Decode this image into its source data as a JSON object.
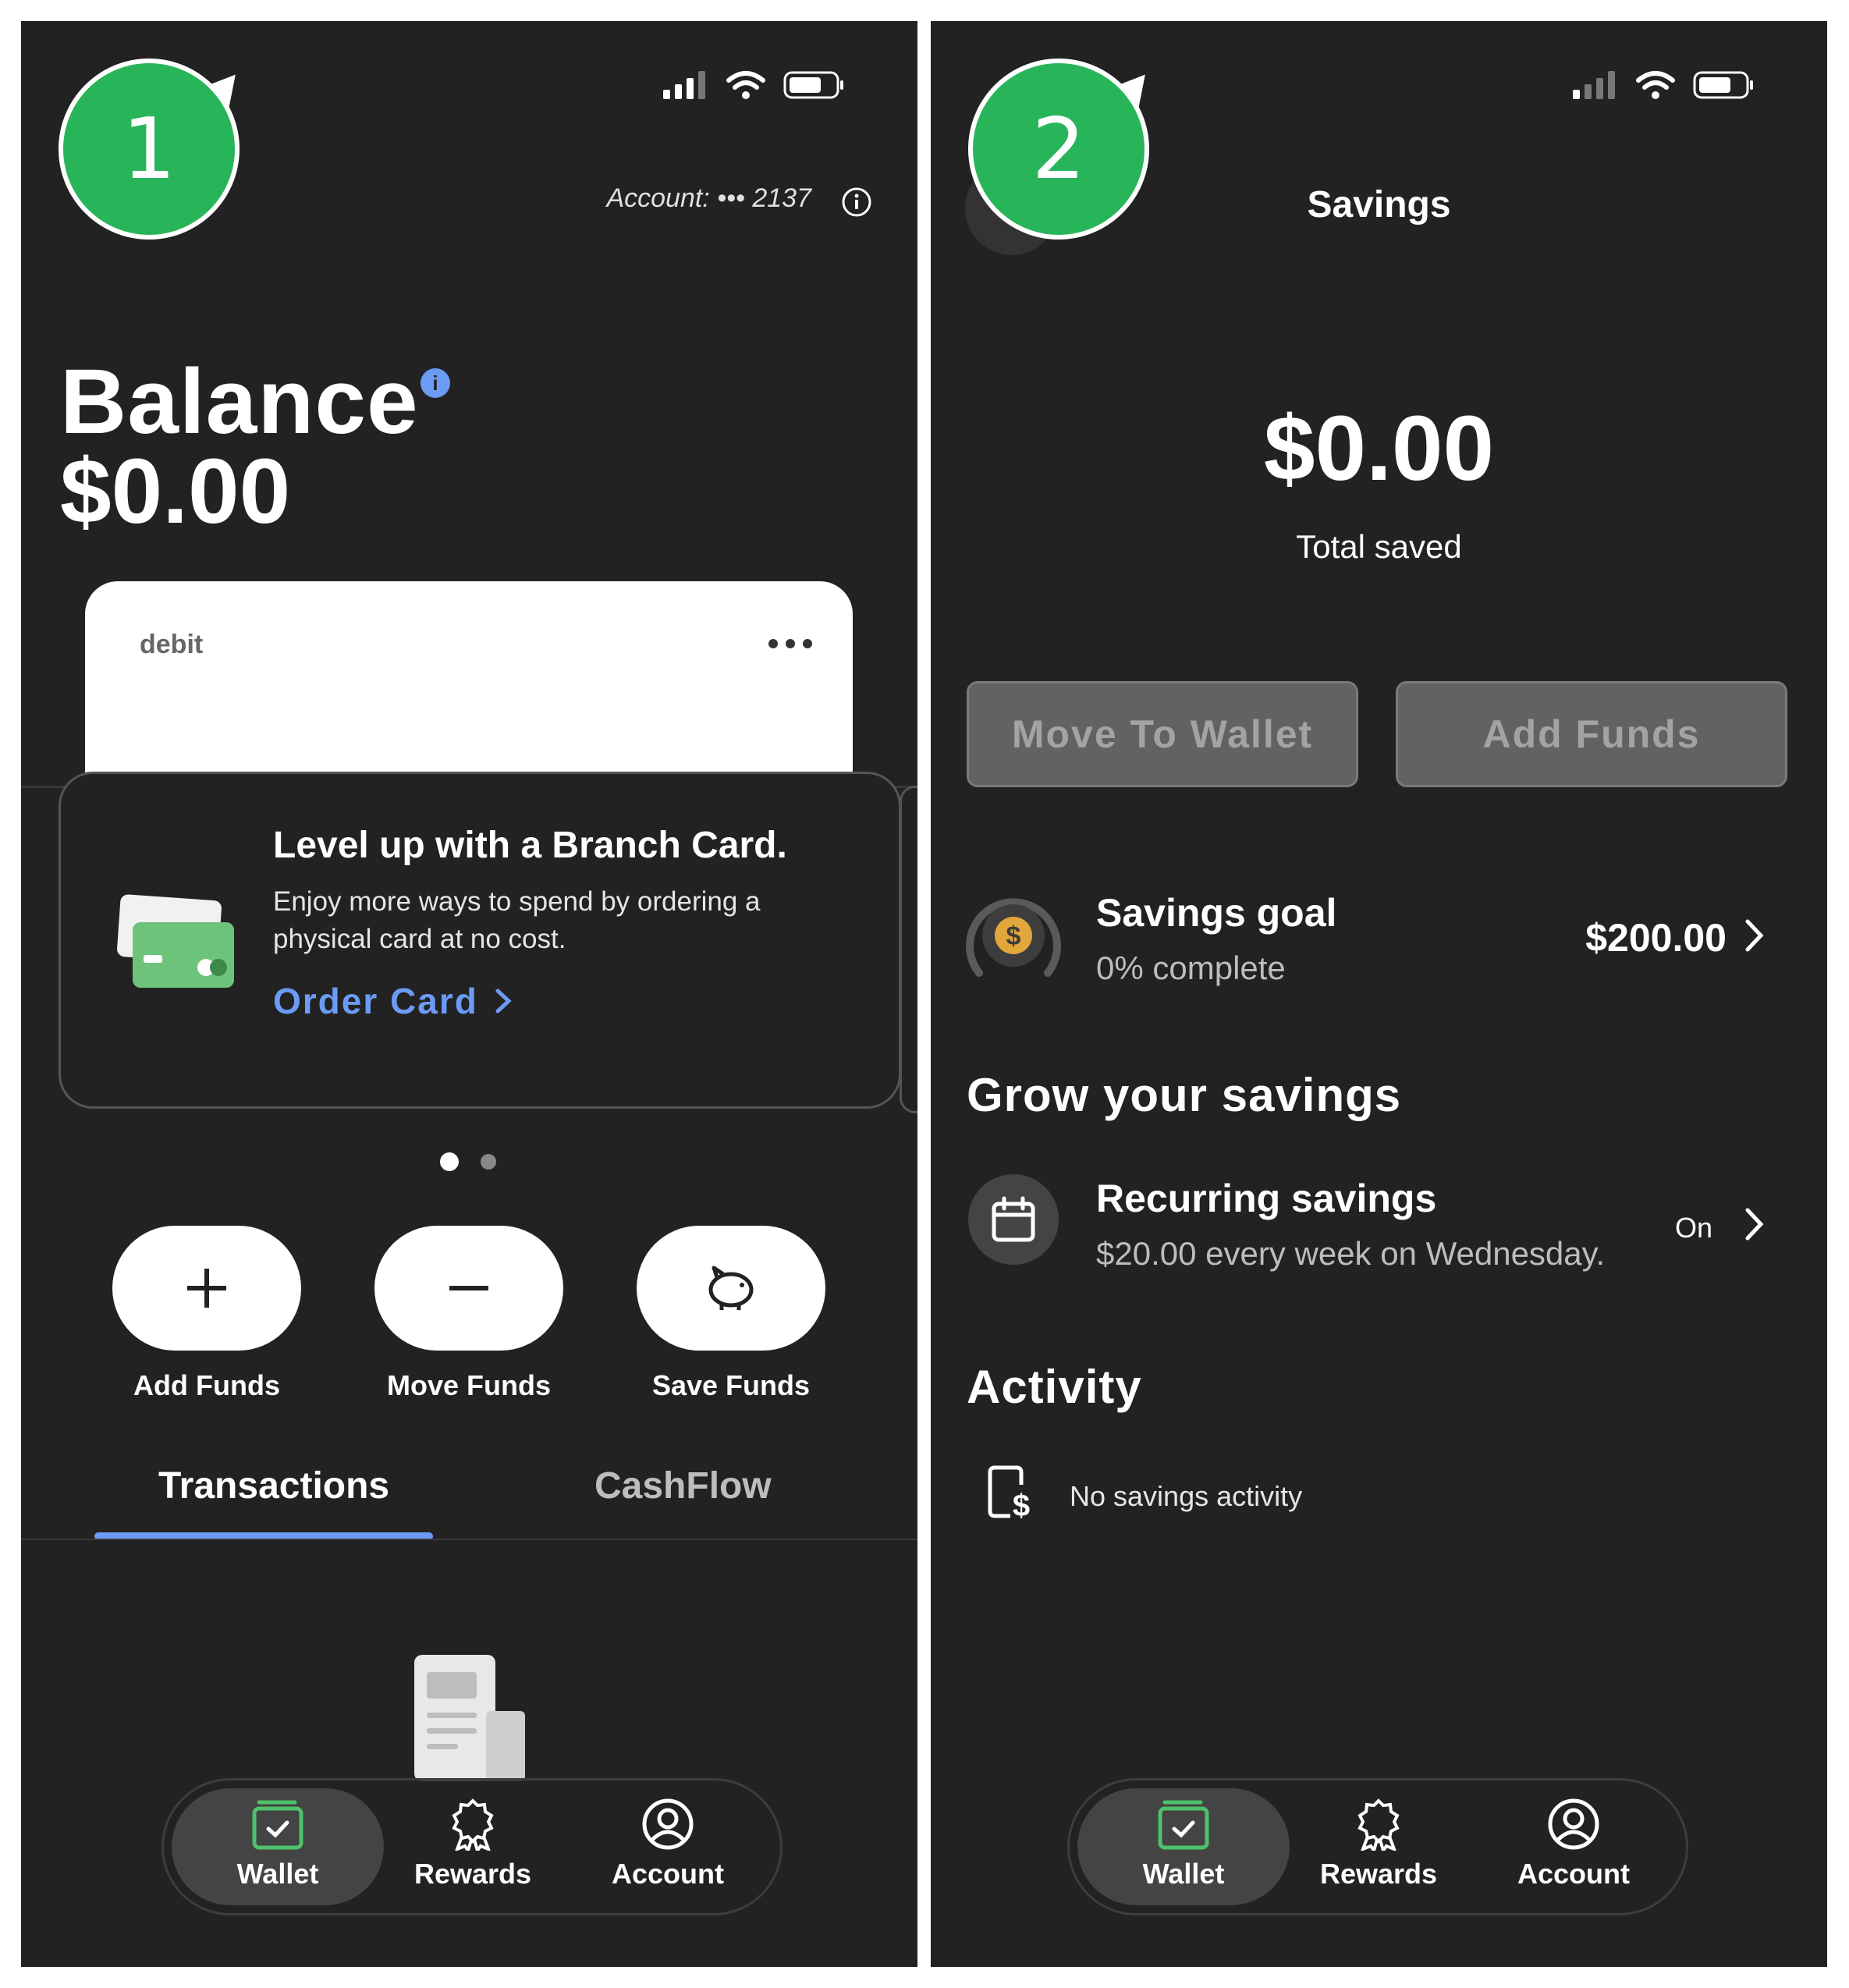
{
  "screen1": {
    "badge": "1",
    "account_label": "Account: ••• 2137",
    "balance_title": "Balance",
    "balance_value": "$0.00",
    "card_label": "debit",
    "promo": {
      "title": "Level up with a Branch Card.",
      "body": "Enjoy more ways to spend by ordering a physical card at no cost.",
      "link": "Order Card"
    },
    "quick_actions": [
      "Add Funds",
      "Move Funds",
      "Save Funds"
    ],
    "tabs": [
      "Transactions",
      "CashFlow"
    ],
    "active_tab": "Transactions",
    "nav": [
      "Wallet",
      "Rewards",
      "Account"
    ]
  },
  "screen2": {
    "badge": "2",
    "title": "Savings",
    "total_value": "$0.00",
    "total_label": "Total saved",
    "buttons": [
      "Move To Wallet",
      "Add Funds"
    ],
    "goal": {
      "title": "Savings goal",
      "sub": "0% complete",
      "amount": "$200.00",
      "progress_percent": 0
    },
    "grow_heading": "Grow your savings",
    "recurring": {
      "title": "Recurring savings",
      "sub": "$20.00 every week on Wednesday.",
      "status": "On"
    },
    "activity_heading": "Activity",
    "activity_empty": "No savings activity",
    "nav": [
      "Wallet",
      "Rewards",
      "Account"
    ]
  },
  "colors": {
    "badge_green": "#28b55a",
    "accent_blue": "#6c9bf5",
    "wallet_green": "#4fc16a",
    "background": "#222222"
  }
}
